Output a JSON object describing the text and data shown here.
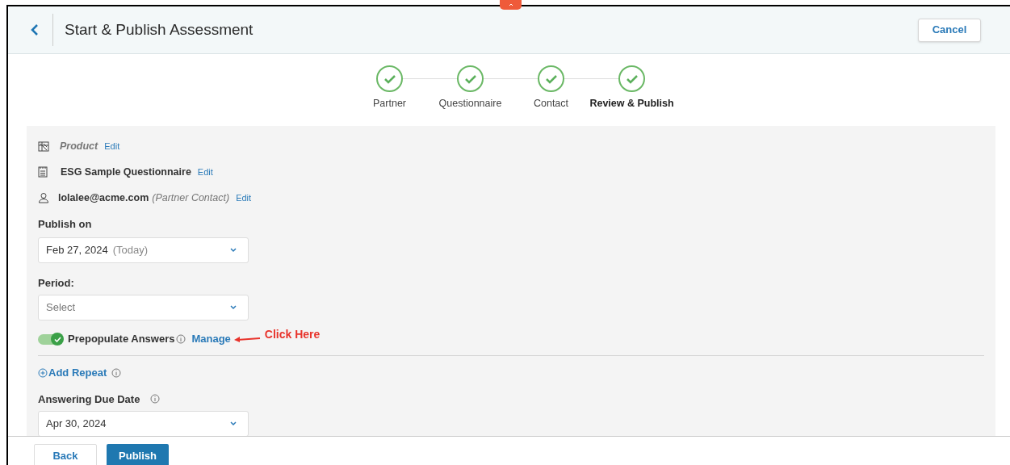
{
  "header": {
    "title": "Start & Publish Assessment",
    "cancel": "Cancel"
  },
  "steps": [
    {
      "label": "Partner",
      "done": true,
      "selected": false
    },
    {
      "label": "Questionnaire",
      "done": true,
      "selected": false
    },
    {
      "label": "Contact",
      "done": true,
      "selected": false
    },
    {
      "label": "Review & Publish",
      "done": true,
      "selected": true
    }
  ],
  "summary": [
    {
      "kind": "product",
      "text": "Product",
      "edit": "Edit"
    },
    {
      "kind": "questionnaire",
      "text": "ESG Sample Questionnaire",
      "edit": "Edit"
    },
    {
      "kind": "contact",
      "text": "lolalee@acme.com",
      "note": "(Partner Contact)",
      "edit": "Edit"
    }
  ],
  "publish_on": {
    "label": "Publish on",
    "value": "Feb 27, 2024",
    "note": "(Today)"
  },
  "period": {
    "label": "Period:",
    "placeholder": "Select"
  },
  "prepopulate": {
    "label": "Prepopulate Answers",
    "on": true,
    "link": "Manage",
    "callout": "Click Here"
  },
  "add_repeat": "Add Repeat",
  "due_date": {
    "label": "Answering Due Date",
    "value": "Apr 30, 2024"
  },
  "footer": {
    "back": "Back",
    "publish": "Publish"
  }
}
